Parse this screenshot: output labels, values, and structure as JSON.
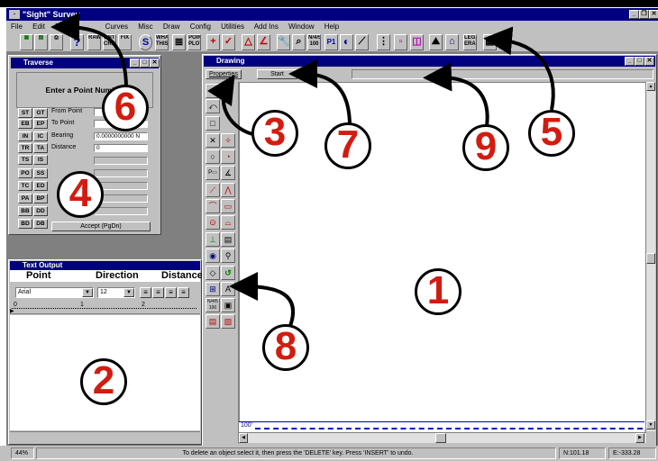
{
  "app": {
    "title": "\"Sight\" Survey"
  },
  "menu": [
    "File",
    "Edit",
    "Points",
    "Curves",
    "Misc",
    "Draw",
    "Config",
    "Utilities",
    "Add Ins",
    "Window",
    "Help"
  ],
  "toolbar": {
    "labels": [
      "?",
      "RAW",
      "ENT CRD",
      "FIX",
      "S",
      "WHATS THIS?",
      "POINT PLOT",
      "LEGAL ERASE",
      "N/4/5 100",
      "P1"
    ]
  },
  "traverse": {
    "title": "Traverse",
    "prompt": "Enter a Point Number",
    "keys": [
      [
        "ST",
        "GT"
      ],
      [
        "EB",
        "EP"
      ],
      [
        "IN",
        "IC"
      ],
      [
        "TR",
        "TA"
      ],
      [
        "TS",
        "IS"
      ],
      [
        "PO",
        "SS"
      ],
      [
        "TC",
        "ED"
      ],
      [
        "PA",
        "BP"
      ],
      [
        "BB",
        "DD"
      ],
      [
        "BD",
        "DB"
      ]
    ],
    "fields": [
      {
        "label": "From Point",
        "value": ""
      },
      {
        "label": "To Point",
        "value": ""
      },
      {
        "label": "Bearing",
        "value": "0.0000000000 N"
      },
      {
        "label": "Distance",
        "value": "0"
      }
    ],
    "accept": "Accept (PgDn)"
  },
  "text_output": {
    "title": "Text Output",
    "columns": [
      "Point",
      "Direction",
      "Distance"
    ],
    "font": "Arial",
    "size": "12",
    "ruler": [
      "0",
      "1",
      "2"
    ]
  },
  "drawing": {
    "title": "Drawing",
    "properties": "Properties",
    "start": "Start",
    "scale_label": "100'"
  },
  "status": {
    "zoom": "44%",
    "message": "To delete an object select it, then press the 'DELETE' key.  Press 'INSERT' to undo.",
    "north": "N:101.18",
    "east": "E:-333.28"
  },
  "callouts": [
    "1",
    "2",
    "3",
    "4",
    "5",
    "6",
    "7",
    "8",
    "9"
  ]
}
